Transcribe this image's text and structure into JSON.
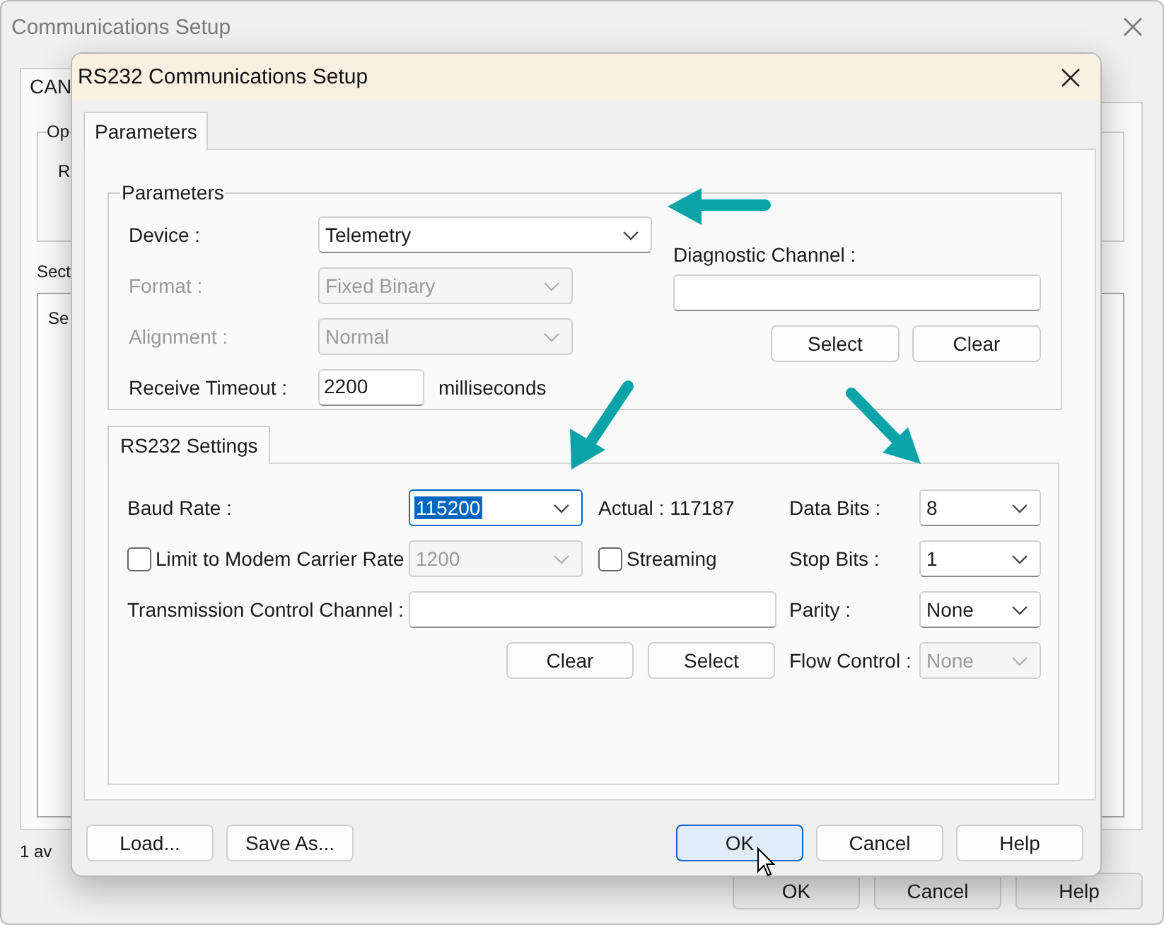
{
  "back_window": {
    "title": "Communications Setup",
    "tabs": [
      {
        "label": "CAN",
        "selected": true
      }
    ],
    "group_label": "Op",
    "group_text": "R",
    "section_label": "Sect",
    "list_item": "Se",
    "status": "1 av",
    "buttons": [
      "OK",
      "Cancel",
      "Help"
    ]
  },
  "dialog": {
    "title": "RS232 Communications Setup",
    "tabs": [
      {
        "label": "Parameters",
        "selected": true
      }
    ],
    "parameters": {
      "title": "Parameters",
      "fields": [
        {
          "kind": "combo",
          "label": "Device :",
          "value": "Telemetry",
          "disabled": false
        },
        {
          "kind": "combo",
          "label": "Format :",
          "value": "Fixed Binary",
          "disabled": true
        },
        {
          "kind": "combo",
          "label": "Alignment :",
          "value": "Normal",
          "disabled": true
        },
        {
          "kind": "text",
          "label": "Receive Timeout :",
          "value": "2200",
          "unit": "milliseconds"
        }
      ],
      "diagnostic": {
        "label": "Diagnostic Channel :",
        "buttons": [
          "Select",
          "Clear"
        ]
      }
    },
    "rs232": {
      "tabs": [
        {
          "label": "RS232 Settings",
          "selected": true
        }
      ],
      "baud": {
        "label": "Baud Rate :",
        "value": "115200",
        "highlighted": true,
        "actual": "Actual : 117187"
      },
      "modem_limit": {
        "label": "Limit to Modem Carrier Rate",
        "checked": false,
        "value": "1200",
        "disabled": true
      },
      "streaming": {
        "label": "Streaming",
        "checked": false
      },
      "transmission": {
        "label": "Transmission Control Channel :",
        "buttons": [
          "Clear",
          "Select"
        ]
      },
      "settings": [
        {
          "label": "Data Bits :",
          "value": "8",
          "disabled": false
        },
        {
          "label": "Stop Bits :",
          "value": "1",
          "disabled": false
        },
        {
          "label": "Parity :",
          "value": "None",
          "disabled": false
        },
        {
          "label": "Flow Control :",
          "value": "None",
          "disabled": true
        }
      ]
    },
    "buttons_left": [
      "Load...",
      "Save As..."
    ],
    "buttons_right": [
      {
        "label": "OK",
        "default": true
      },
      {
        "label": "Cancel",
        "default": false
      },
      {
        "label": "Help",
        "default": false
      }
    ]
  }
}
